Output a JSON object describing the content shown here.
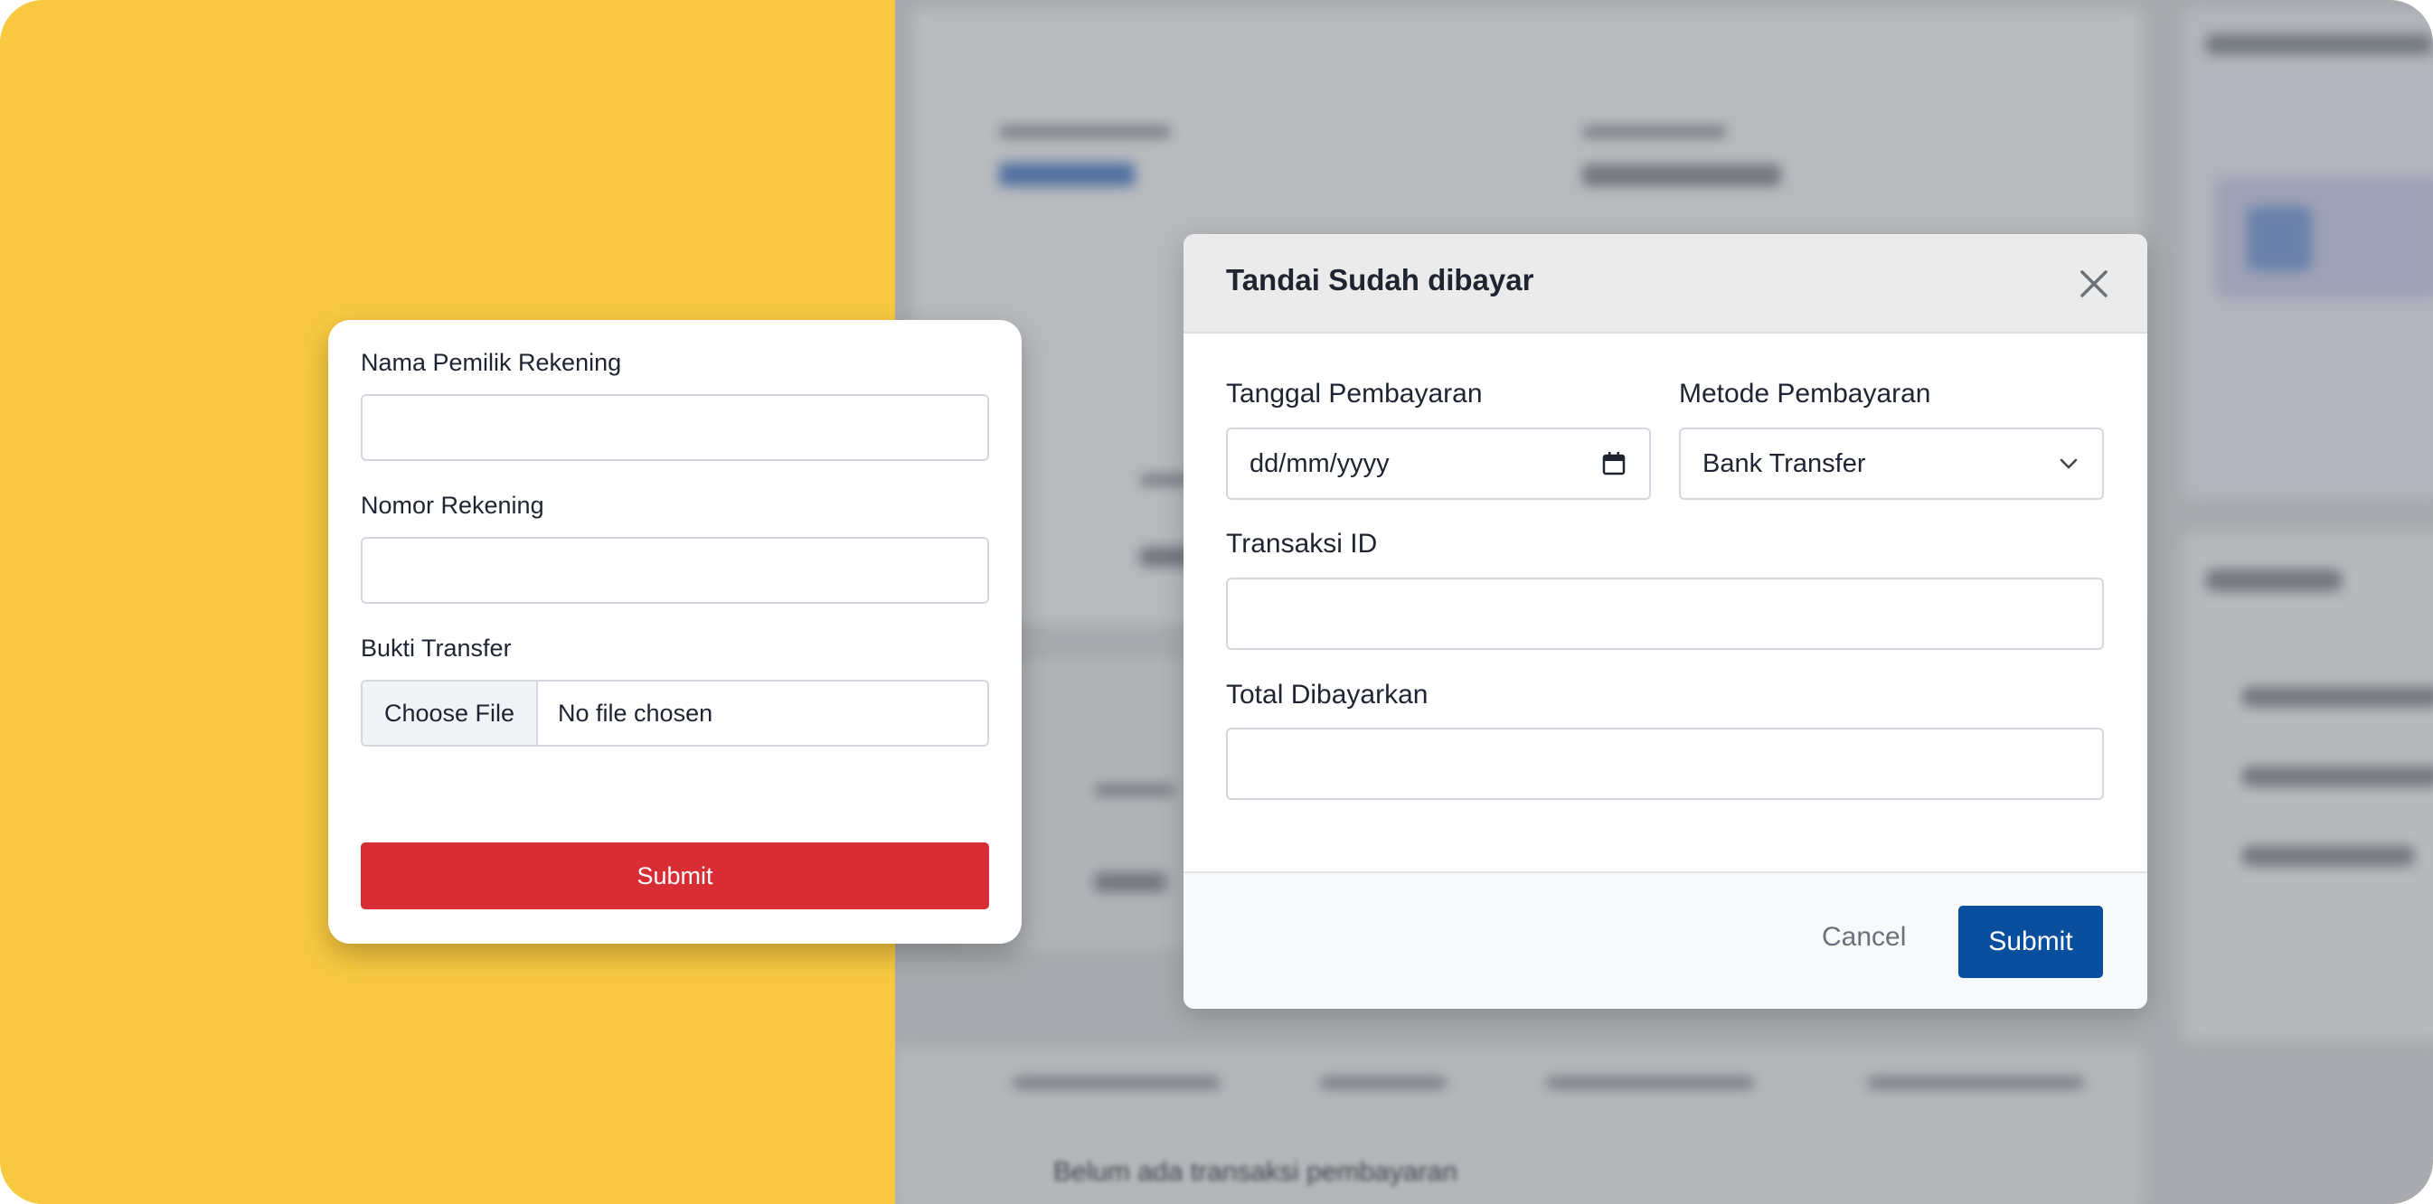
{
  "colors": {
    "background_accent": "#f8c940",
    "danger_button": "#d92d35",
    "primary_button": "#0a4f9e"
  },
  "left_form": {
    "account_name_label": "Nama Pemilik Rekening",
    "account_number_label": "Nomor Rekening",
    "proof_label": "Bukti Transfer",
    "choose_file_label": "Choose File",
    "no_file_label": "No file chosen",
    "submit_label": "Submit"
  },
  "modal": {
    "title": "Tandai Sudah dibayar",
    "payment_date_label": "Tanggal Pembayaran",
    "payment_date_placeholder": "dd/mm/yyyy",
    "payment_method_label": "Metode Pembayaran",
    "payment_method_value": "Bank Transfer",
    "transaction_id_label": "Transaksi ID",
    "total_paid_label": "Total Dibayarkan",
    "cancel_label": "Cancel",
    "submit_label": "Submit"
  },
  "background": {
    "blurred_text": "Belum ada transaksi pembayaran"
  }
}
